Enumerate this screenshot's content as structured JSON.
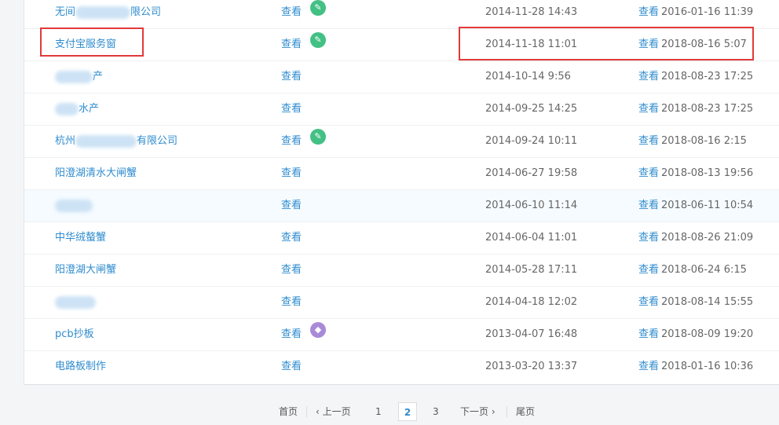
{
  "rows": [
    {
      "name": "无间",
      "name_suffix": "限公司",
      "view": "查看",
      "badge": "green",
      "badge_icon": "pencil-icon",
      "date": "2014-11-28 14:43",
      "last_view": "查看",
      "last_date": "2016-01-16 11:39"
    },
    {
      "name": "支付宝服务窗",
      "name_suffix": "",
      "view": "查看",
      "badge": "green",
      "badge_icon": "pencil-icon",
      "date": "2014-11-18 11:01",
      "last_view": "查看",
      "last_date": "2018-08-16 5:07"
    },
    {
      "name": "",
      "name_suffix": "产",
      "view": "查看",
      "badge": "",
      "date": "2014-10-14 9:56",
      "last_view": "查看",
      "last_date": "2018-08-23 17:25"
    },
    {
      "name": "",
      "name_suffix": "水产",
      "view": "查看",
      "badge": "",
      "date": "2014-09-25 14:25",
      "last_view": "查看",
      "last_date": "2018-08-23 17:25"
    },
    {
      "name": "杭州",
      "name_suffix": "有限公司",
      "view": "查看",
      "badge": "green",
      "badge_icon": "pencil-icon",
      "date": "2014-09-24 10:11",
      "last_view": "查看",
      "last_date": "2018-08-16 2:15"
    },
    {
      "name": "阳澄湖清水大闸蟹",
      "name_suffix": "",
      "view": "查看",
      "badge": "",
      "date": "2014-06-27 19:58",
      "last_view": "查看",
      "last_date": "2018-08-13 19:56"
    },
    {
      "name": "",
      "name_suffix": "",
      "view": "查看",
      "badge": "",
      "date": "2014-06-10 11:14",
      "last_view": "查看",
      "last_date": "2018-06-11 10:54"
    },
    {
      "name": "中华绒螯蟹",
      "name_suffix": "",
      "view": "查看",
      "badge": "",
      "date": "2014-06-04 11:01",
      "last_view": "查看",
      "last_date": "2018-08-26 21:09"
    },
    {
      "name": "阳澄湖大闸蟹",
      "name_suffix": "",
      "view": "查看",
      "badge": "",
      "date": "2014-05-28 17:11",
      "last_view": "查看",
      "last_date": "2018-06-24 6:15"
    },
    {
      "name": "",
      "name_suffix": "",
      "view": "查看",
      "badge": "",
      "date": "2014-04-18 12:02",
      "last_view": "查看",
      "last_date": "2018-08-14 15:55"
    },
    {
      "name": "pcb抄板",
      "name_suffix": "",
      "view": "查看",
      "badge": "purple",
      "badge_icon": "layers-icon",
      "date": "2013-04-07 16:48",
      "last_view": "查看",
      "last_date": "2018-08-09 19:20"
    },
    {
      "name": "电路板制作",
      "name_suffix": "",
      "view": "查看",
      "badge": "",
      "date": "2013-03-20 13:37",
      "last_view": "查看",
      "last_date": "2018-01-16 10:36"
    }
  ],
  "pagination": {
    "first": "首页",
    "prev": "上一页",
    "pages": [
      "1",
      "2",
      "3"
    ],
    "current": "2",
    "next": "下一页",
    "last": "尾页"
  },
  "colors": {
    "link": "#2f8ccf",
    "highlight_box": "#e23a3a",
    "badge_green": "#43c084",
    "badge_purple": "#a98ad8"
  }
}
